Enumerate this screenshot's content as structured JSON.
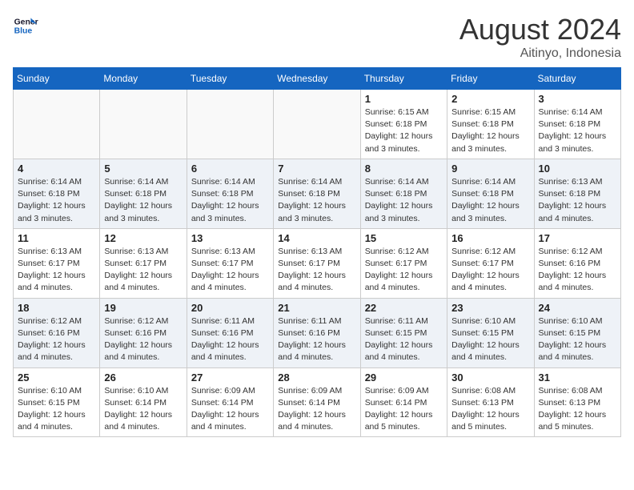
{
  "logo": {
    "line1": "General",
    "line2": "Blue"
  },
  "title": "August 2024",
  "location": "Aitinyo, Indonesia",
  "days_of_week": [
    "Sunday",
    "Monday",
    "Tuesday",
    "Wednesday",
    "Thursday",
    "Friday",
    "Saturday"
  ],
  "weeks": [
    [
      {
        "day": "",
        "info": ""
      },
      {
        "day": "",
        "info": ""
      },
      {
        "day": "",
        "info": ""
      },
      {
        "day": "",
        "info": ""
      },
      {
        "day": "1",
        "info": "Sunrise: 6:15 AM\nSunset: 6:18 PM\nDaylight: 12 hours\nand 3 minutes."
      },
      {
        "day": "2",
        "info": "Sunrise: 6:15 AM\nSunset: 6:18 PM\nDaylight: 12 hours\nand 3 minutes."
      },
      {
        "day": "3",
        "info": "Sunrise: 6:14 AM\nSunset: 6:18 PM\nDaylight: 12 hours\nand 3 minutes."
      }
    ],
    [
      {
        "day": "4",
        "info": "Sunrise: 6:14 AM\nSunset: 6:18 PM\nDaylight: 12 hours\nand 3 minutes."
      },
      {
        "day": "5",
        "info": "Sunrise: 6:14 AM\nSunset: 6:18 PM\nDaylight: 12 hours\nand 3 minutes."
      },
      {
        "day": "6",
        "info": "Sunrise: 6:14 AM\nSunset: 6:18 PM\nDaylight: 12 hours\nand 3 minutes."
      },
      {
        "day": "7",
        "info": "Sunrise: 6:14 AM\nSunset: 6:18 PM\nDaylight: 12 hours\nand 3 minutes."
      },
      {
        "day": "8",
        "info": "Sunrise: 6:14 AM\nSunset: 6:18 PM\nDaylight: 12 hours\nand 3 minutes."
      },
      {
        "day": "9",
        "info": "Sunrise: 6:14 AM\nSunset: 6:18 PM\nDaylight: 12 hours\nand 3 minutes."
      },
      {
        "day": "10",
        "info": "Sunrise: 6:13 AM\nSunset: 6:18 PM\nDaylight: 12 hours\nand 4 minutes."
      }
    ],
    [
      {
        "day": "11",
        "info": "Sunrise: 6:13 AM\nSunset: 6:17 PM\nDaylight: 12 hours\nand 4 minutes."
      },
      {
        "day": "12",
        "info": "Sunrise: 6:13 AM\nSunset: 6:17 PM\nDaylight: 12 hours\nand 4 minutes."
      },
      {
        "day": "13",
        "info": "Sunrise: 6:13 AM\nSunset: 6:17 PM\nDaylight: 12 hours\nand 4 minutes."
      },
      {
        "day": "14",
        "info": "Sunrise: 6:13 AM\nSunset: 6:17 PM\nDaylight: 12 hours\nand 4 minutes."
      },
      {
        "day": "15",
        "info": "Sunrise: 6:12 AM\nSunset: 6:17 PM\nDaylight: 12 hours\nand 4 minutes."
      },
      {
        "day": "16",
        "info": "Sunrise: 6:12 AM\nSunset: 6:17 PM\nDaylight: 12 hours\nand 4 minutes."
      },
      {
        "day": "17",
        "info": "Sunrise: 6:12 AM\nSunset: 6:16 PM\nDaylight: 12 hours\nand 4 minutes."
      }
    ],
    [
      {
        "day": "18",
        "info": "Sunrise: 6:12 AM\nSunset: 6:16 PM\nDaylight: 12 hours\nand 4 minutes."
      },
      {
        "day": "19",
        "info": "Sunrise: 6:12 AM\nSunset: 6:16 PM\nDaylight: 12 hours\nand 4 minutes."
      },
      {
        "day": "20",
        "info": "Sunrise: 6:11 AM\nSunset: 6:16 PM\nDaylight: 12 hours\nand 4 minutes."
      },
      {
        "day": "21",
        "info": "Sunrise: 6:11 AM\nSunset: 6:16 PM\nDaylight: 12 hours\nand 4 minutes."
      },
      {
        "day": "22",
        "info": "Sunrise: 6:11 AM\nSunset: 6:15 PM\nDaylight: 12 hours\nand 4 minutes."
      },
      {
        "day": "23",
        "info": "Sunrise: 6:10 AM\nSunset: 6:15 PM\nDaylight: 12 hours\nand 4 minutes."
      },
      {
        "day": "24",
        "info": "Sunrise: 6:10 AM\nSunset: 6:15 PM\nDaylight: 12 hours\nand 4 minutes."
      }
    ],
    [
      {
        "day": "25",
        "info": "Sunrise: 6:10 AM\nSunset: 6:15 PM\nDaylight: 12 hours\nand 4 minutes."
      },
      {
        "day": "26",
        "info": "Sunrise: 6:10 AM\nSunset: 6:14 PM\nDaylight: 12 hours\nand 4 minutes."
      },
      {
        "day": "27",
        "info": "Sunrise: 6:09 AM\nSunset: 6:14 PM\nDaylight: 12 hours\nand 4 minutes."
      },
      {
        "day": "28",
        "info": "Sunrise: 6:09 AM\nSunset: 6:14 PM\nDaylight: 12 hours\nand 4 minutes."
      },
      {
        "day": "29",
        "info": "Sunrise: 6:09 AM\nSunset: 6:14 PM\nDaylight: 12 hours\nand 5 minutes."
      },
      {
        "day": "30",
        "info": "Sunrise: 6:08 AM\nSunset: 6:13 PM\nDaylight: 12 hours\nand 5 minutes."
      },
      {
        "day": "31",
        "info": "Sunrise: 6:08 AM\nSunset: 6:13 PM\nDaylight: 12 hours\nand 5 minutes."
      }
    ]
  ]
}
